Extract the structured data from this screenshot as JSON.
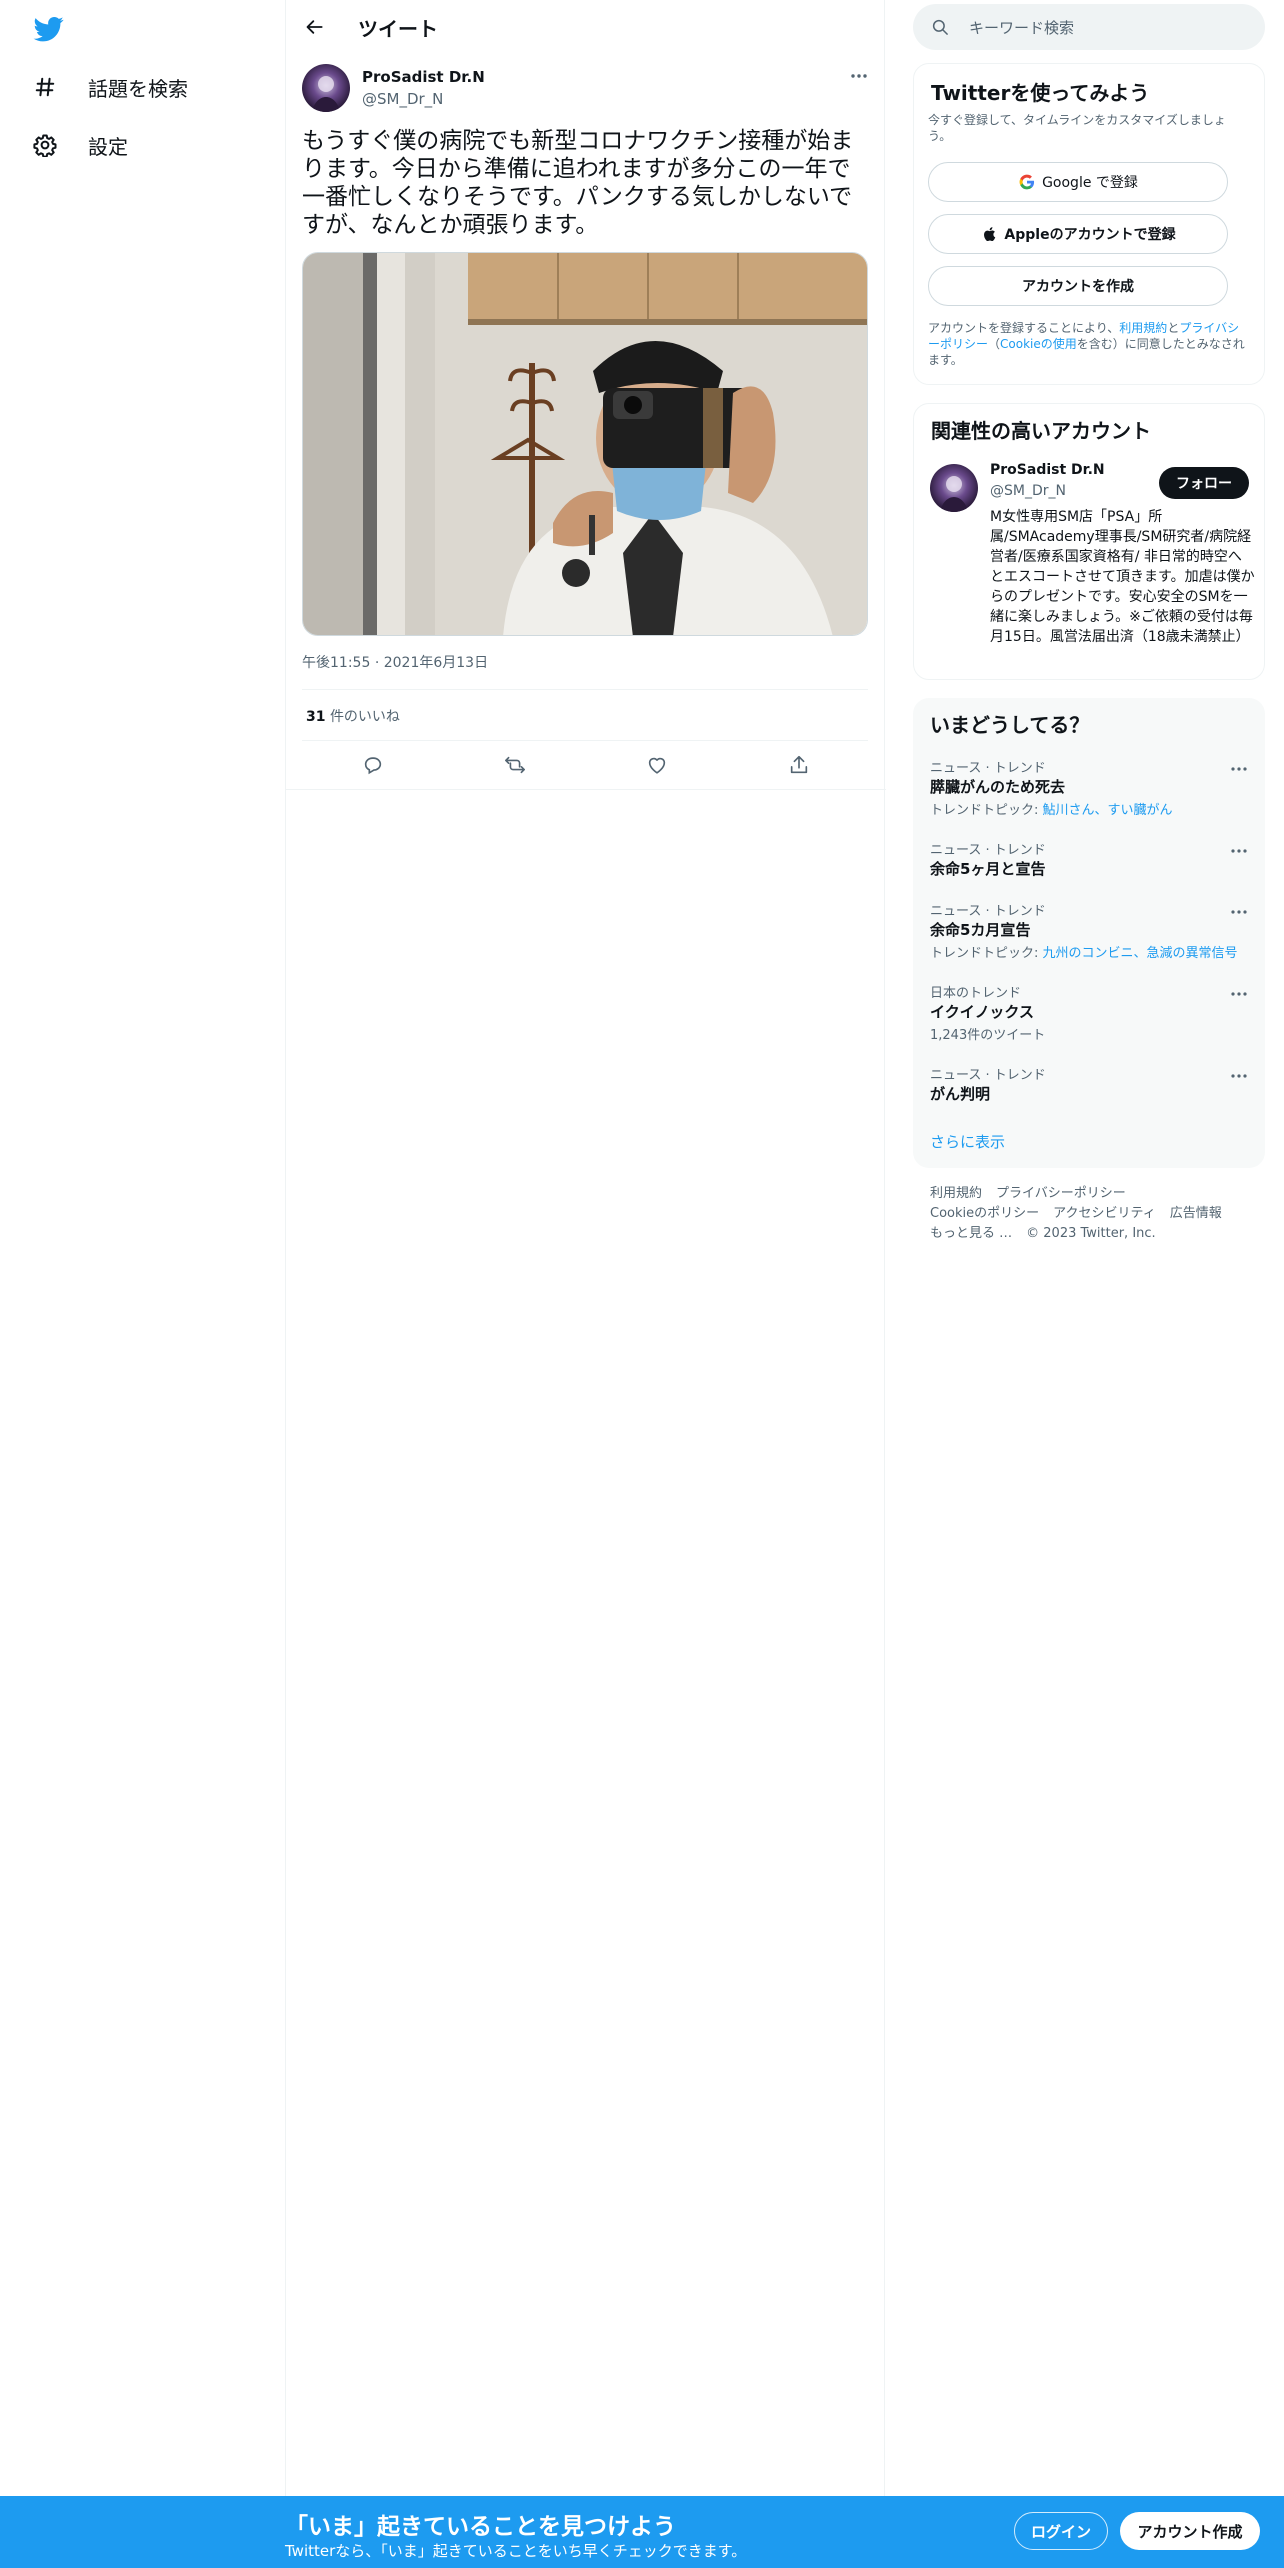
{
  "sidebar": {
    "logo_icon": "twitter-bird-icon",
    "brand_color": "#1d9bf0",
    "items": [
      {
        "label": "話題を検索",
        "icon": "hashtag-icon"
      },
      {
        "label": "設定",
        "icon": "gear-icon"
      }
    ]
  },
  "header": {
    "title": "ツイート",
    "back_icon": "back-arrow-icon"
  },
  "tweet": {
    "author_name": "ProSadist Dr.N",
    "author_handle": "@SM_Dr_N",
    "text": "もうすぐ僕の病院でも新型コロナワクチン接種が始まります。今日から準備に追われますが多分この一年で一番忙しくなりそうです。パンクする気しかしないですが、なんとか頑張ります。",
    "time": "午後11:55",
    "date": "2021年6月13日",
    "likes_count": "31",
    "likes_label": "件のいいね",
    "actions": [
      "reply-icon",
      "retweet-icon",
      "like-icon",
      "share-icon"
    ]
  },
  "search": {
    "placeholder": "キーワード検索"
  },
  "signup_card": {
    "title": "Twitterを使ってみよう",
    "subtitle": "今すぐ登録して、タイムラインをカスタマイズしましょう。",
    "google_label": "Google で登録",
    "apple_label": "Appleのアカウントで登録",
    "create_label": "アカウントを作成",
    "legal_prefix": "アカウントを登録することにより、",
    "legal_terms": "利用規約",
    "legal_and": "と",
    "legal_privacy": "プライバシーポリシー",
    "legal_open": "（",
    "legal_cookie": "Cookieの使用",
    "legal_suffix": "を含む）に同意したとみなされます。"
  },
  "related": {
    "title": "関連性の高いアカウント",
    "name": "ProSadist Dr.N",
    "handle": "@SM_Dr_N",
    "follow_label": "フォロー",
    "bio": "M女性専用SM店「PSA」所属/SMAcademy理事長/SM研究者/病院経営者/医療系国家資格有/ 非日常的時空へとエスコートさせて頂きます。加虐は僕からのプレゼントです。安心安全のSMを一緒に楽しみましょう。※ご依頼の受付は毎月15日。風営法届出済（18歳未満禁止）"
  },
  "trends": {
    "title": "いまどうしてる？",
    "items": [
      {
        "category": "ニュース · トレンド",
        "name": "膵臓がんのため死去",
        "extra_prefix": "トレンドトピック: ",
        "extra_link": "鮎川さん、すい臓がん"
      },
      {
        "category": "ニュース · トレンド",
        "name": "余命5ヶ月と宣告",
        "extra_prefix": "",
        "extra_link": ""
      },
      {
        "category": "ニュース · トレンド",
        "name": "余命5カ月宣告",
        "extra_prefix": "トレンドトピック: ",
        "extra_link": "九州のコンビニ、急減の異常信号"
      },
      {
        "category": "日本のトレンド",
        "name": "イクイノックス",
        "extra_prefix": "1,243件のツイート",
        "extra_link": ""
      },
      {
        "category": "ニュース · トレンド",
        "name": "がん判明",
        "extra_prefix": "",
        "extra_link": ""
      }
    ],
    "show_more": "さらに表示"
  },
  "footer": {
    "links_row1": [
      "利用規約",
      "プライバシーポリシー"
    ],
    "links_row2": [
      "Cookieのポリシー",
      "アクセシビリティ",
      "広告情報"
    ],
    "more": "もっと見る …",
    "copyright": "© 2023 Twitter, Inc."
  },
  "banner": {
    "title": "「いま」起きていることを見つけよう",
    "subtitle": "Twitterなら、「いま」起きていることをいち早くチェックできます。",
    "login_label": "ログイン",
    "signup_label": "アカウント作成"
  }
}
